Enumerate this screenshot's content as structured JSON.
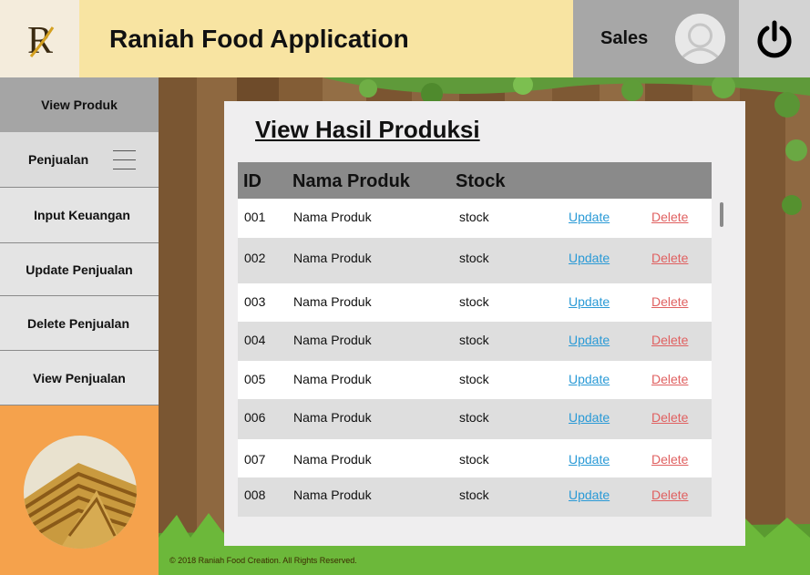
{
  "header": {
    "logo_glyph": "R",
    "title": "Raniah Food Application",
    "user_role": "Sales"
  },
  "sidebar": {
    "items": [
      {
        "label": "View Produk"
      },
      {
        "label": "Penjualan"
      },
      {
        "label": "Input Keuangan"
      },
      {
        "label": "Update Penjualan"
      },
      {
        "label": "Delete Penjualan"
      },
      {
        "label": "View Penjualan"
      }
    ]
  },
  "main": {
    "title": "View Hasil Produksi",
    "columns": [
      "ID",
      "Nama Produk",
      "Stock"
    ],
    "rows": [
      {
        "id": "001",
        "name": "Nama Produk",
        "stock": "stock",
        "update": "Update",
        "delete": "Delete"
      },
      {
        "id": "002",
        "name": "Nama Produk",
        "stock": "stock",
        "update": "Update",
        "delete": "Delete"
      },
      {
        "id": "003",
        "name": "Nama Produk",
        "stock": "stock",
        "update": "Update",
        "delete": "Delete"
      },
      {
        "id": "004",
        "name": "Nama Produk",
        "stock": "stock",
        "update": "Update",
        "delete": "Delete"
      },
      {
        "id": "005",
        "name": "Nama Produk",
        "stock": "stock",
        "update": "Update",
        "delete": "Delete"
      },
      {
        "id": "006",
        "name": "Nama Produk",
        "stock": "stock",
        "update": "Update",
        "delete": "Delete"
      },
      {
        "id": "007",
        "name": "Nama Produk",
        "stock": "stock",
        "update": "Update",
        "delete": "Delete"
      },
      {
        "id": "008",
        "name": "Nama Produk",
        "stock": "stock",
        "update": "Update",
        "delete": "Delete"
      }
    ]
  },
  "footer": {
    "text": "© 2018 Raniah Food Creation. All Rights Reserved."
  },
  "colors": {
    "header_bg": "#f8e4a2",
    "sidebar_accent": "#f5a24c",
    "update_link": "#2a9ad6",
    "delete_link": "#e06060"
  },
  "icons": [
    "logo-icon",
    "user-avatar-icon",
    "power-icon",
    "hamburger-icon"
  ]
}
